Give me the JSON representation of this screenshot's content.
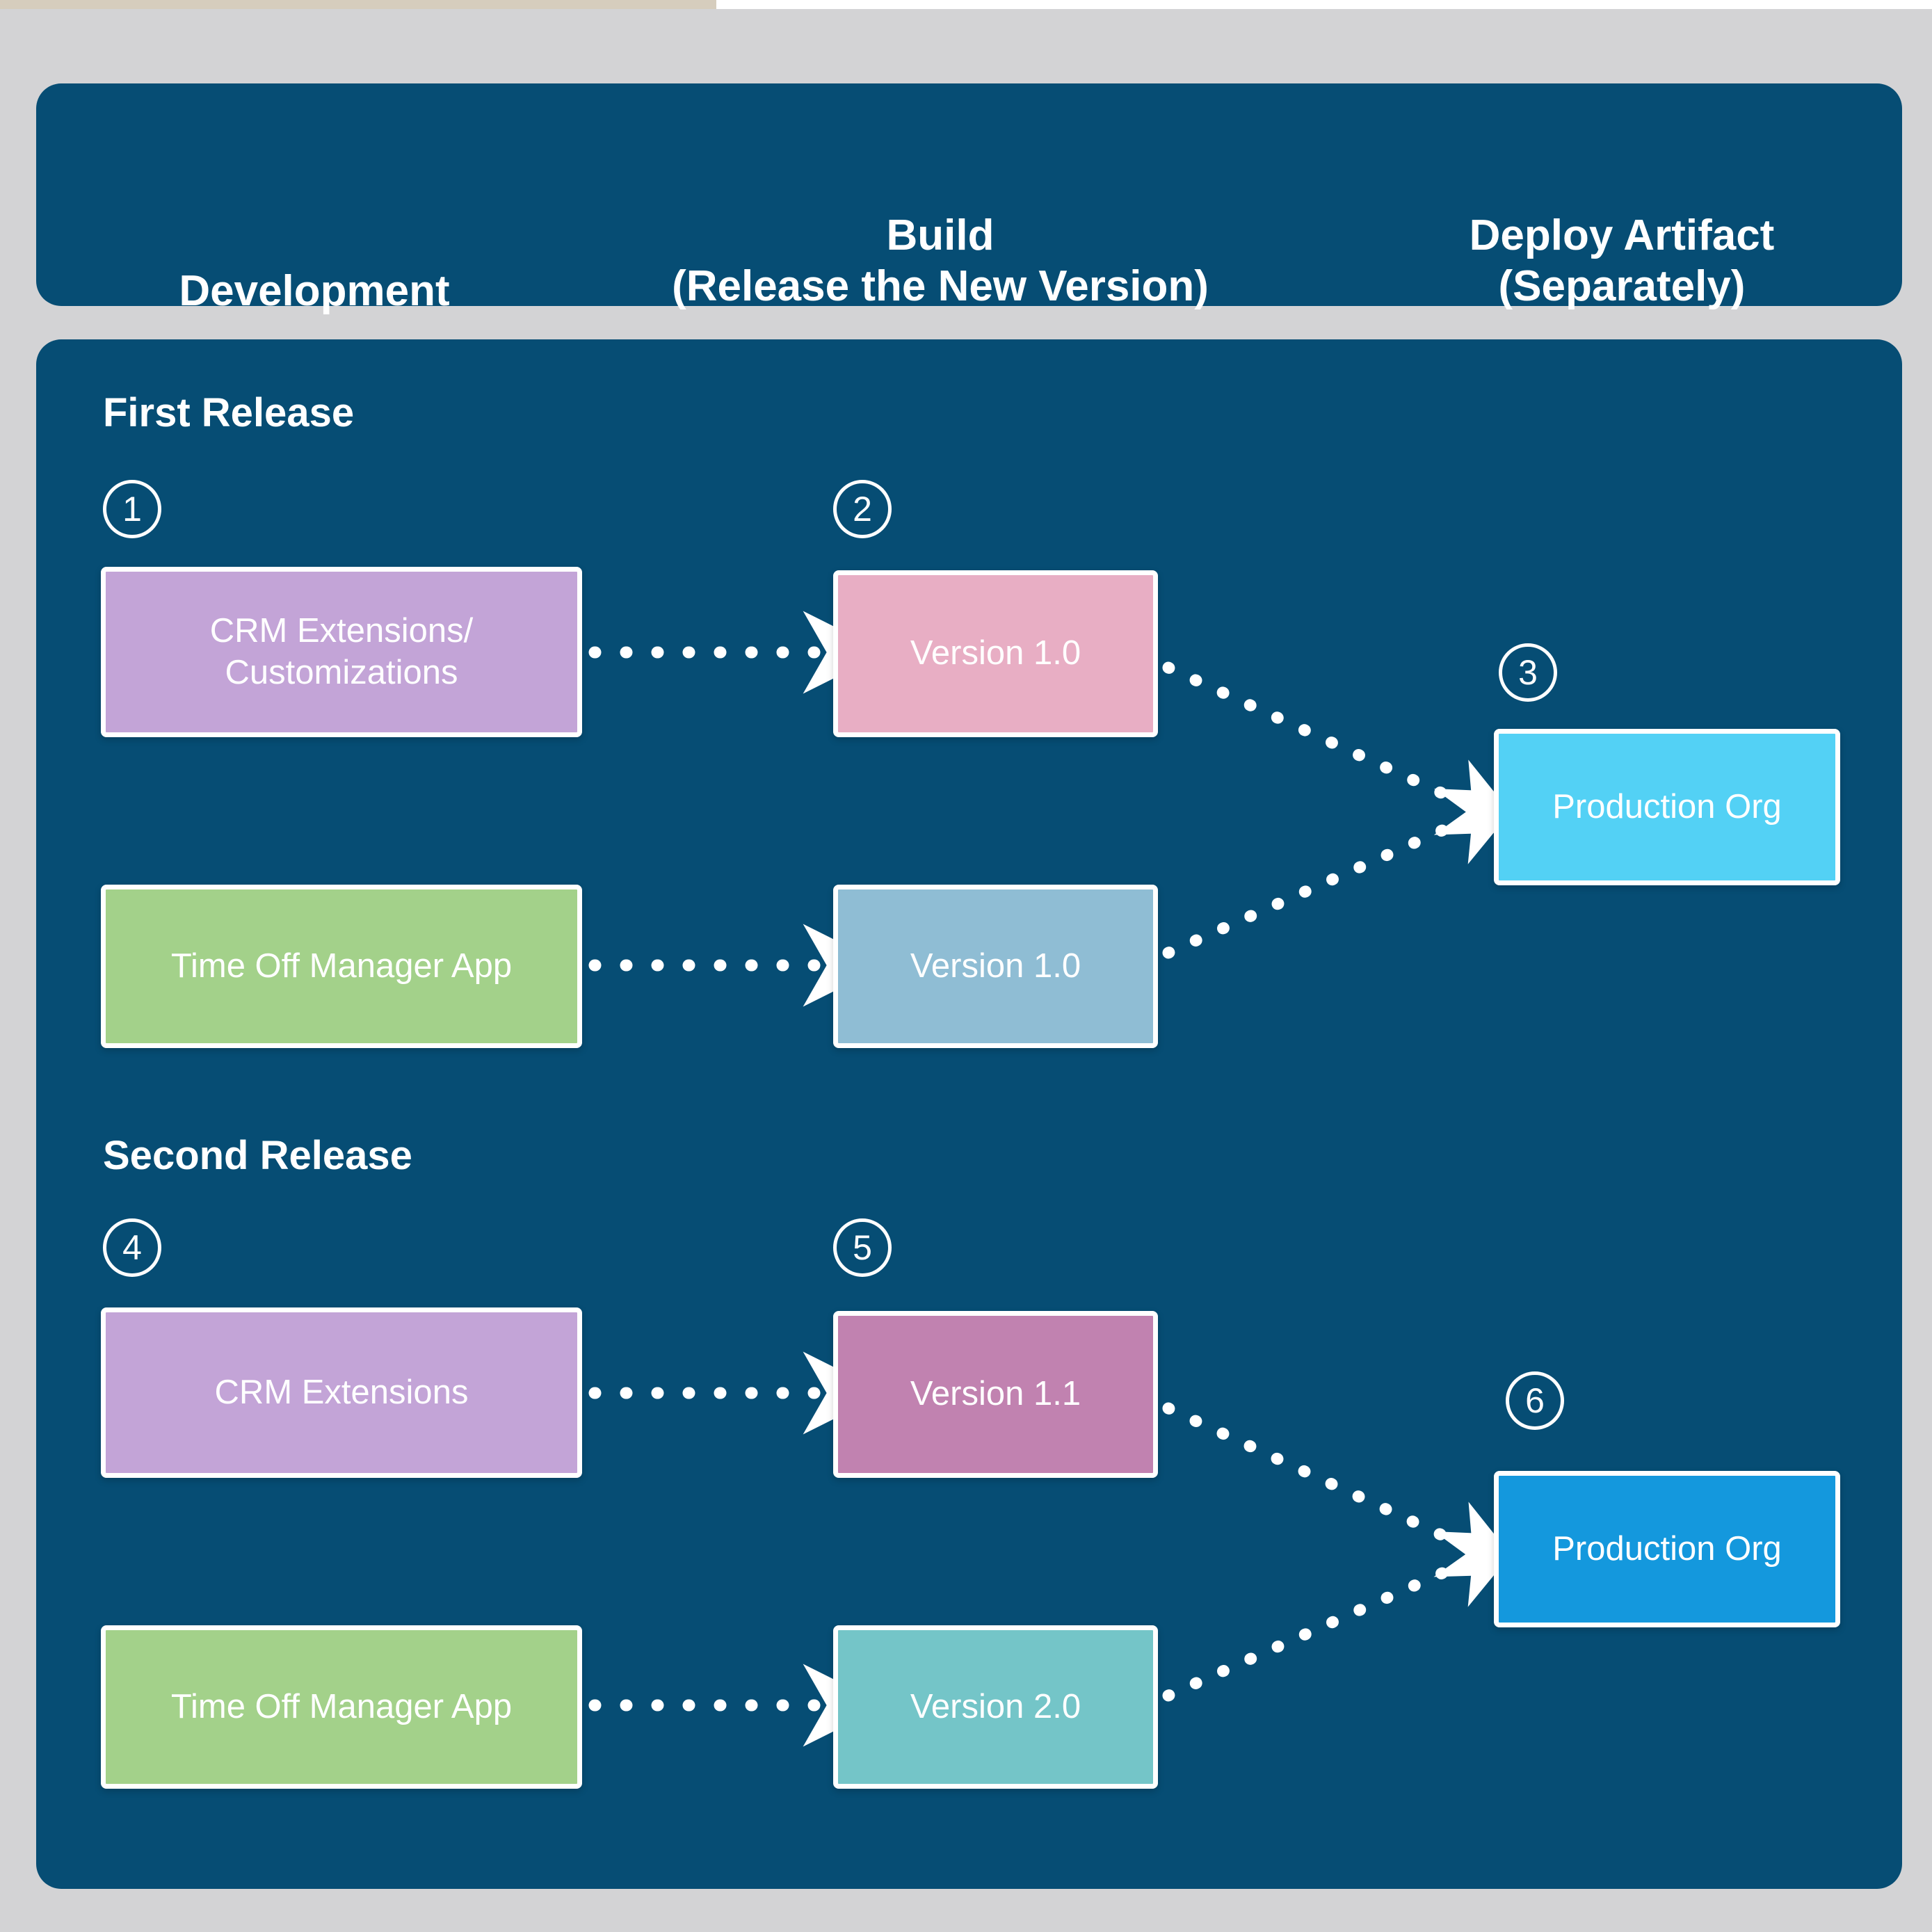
{
  "page": {
    "background_color": "#d3d3d5",
    "panel_color": "#064d74"
  },
  "header": {
    "columns": [
      {
        "id": "development",
        "label": "Development"
      },
      {
        "id": "build",
        "label": "Build\n(Release the New Version)",
        "line1": "Build",
        "line2": "(Release the New Version)"
      },
      {
        "id": "deploy",
        "label": "Deploy Artifact\n(Separately)",
        "line1": "Deploy Artifact",
        "line2": "(Separately)"
      }
    ]
  },
  "sections": [
    {
      "id": "first-release",
      "title": "First Release",
      "steps": [
        {
          "number": "1",
          "column": "development"
        },
        {
          "number": "2",
          "column": "build"
        },
        {
          "number": "3",
          "column": "deploy"
        }
      ],
      "nodes": [
        {
          "id": "crm-extensions-customizations",
          "label": "CRM Extensions/\nCustomizations",
          "line1": "CRM Extensions/",
          "line2": "Customizations",
          "color": "#c3a4d7",
          "column": "development"
        },
        {
          "id": "version-1-0-crm",
          "label": "Version 1.0",
          "color": "#e8aec4",
          "column": "build"
        },
        {
          "id": "time-off-manager-app-1",
          "label": "Time Off Manager App",
          "color": "#a3d18a",
          "column": "development"
        },
        {
          "id": "version-1-0-timeoff",
          "label": "Version 1.0",
          "color": "#8fbdd4",
          "column": "build"
        },
        {
          "id": "production-org-1",
          "label": "Production Org",
          "color": "#53d1f5",
          "column": "deploy"
        }
      ]
    },
    {
      "id": "second-release",
      "title": "Second Release",
      "steps": [
        {
          "number": "4",
          "column": "development"
        },
        {
          "number": "5",
          "column": "build"
        },
        {
          "number": "6",
          "column": "deploy"
        }
      ],
      "nodes": [
        {
          "id": "crm-extensions",
          "label": "CRM Extensions",
          "color": "#c3a4d7",
          "column": "development"
        },
        {
          "id": "version-1-1",
          "label": "Version 1.1",
          "color": "#c182b0",
          "column": "build"
        },
        {
          "id": "time-off-manager-app-2",
          "label": "Time Off Manager App",
          "color": "#a3d18a",
          "column": "development"
        },
        {
          "id": "version-2-0",
          "label": "Version 2.0",
          "color": "#74c5c8",
          "column": "build"
        },
        {
          "id": "production-org-2",
          "label": "Production Org",
          "color": "#1498dd",
          "column": "deploy"
        }
      ]
    }
  ],
  "edges": [
    {
      "id": "edge-crm-to-v10",
      "from": "crm-extensions-customizations",
      "to": "version-1-0-crm",
      "style": "dotted-arrow"
    },
    {
      "id": "edge-v10crm-to-prod1",
      "from": "version-1-0-crm",
      "to": "production-org-1",
      "style": "dotted-arrow"
    },
    {
      "id": "edge-timeoff1-to-v10",
      "from": "time-off-manager-app-1",
      "to": "version-1-0-timeoff",
      "style": "dotted-arrow"
    },
    {
      "id": "edge-v10timeoff-to-prod1",
      "from": "version-1-0-timeoff",
      "to": "production-org-1",
      "style": "dotted-arrow"
    },
    {
      "id": "edge-crmext-to-v11",
      "from": "crm-extensions",
      "to": "version-1-1",
      "style": "dotted-arrow"
    },
    {
      "id": "edge-v11-to-prod2",
      "from": "version-1-1",
      "to": "production-org-2",
      "style": "dotted-arrow"
    },
    {
      "id": "edge-timeoff2-to-v20",
      "from": "time-off-manager-app-2",
      "to": "version-2-0",
      "style": "dotted-arrow"
    },
    {
      "id": "edge-v20-to-prod2",
      "from": "version-2-0",
      "to": "production-org-2",
      "style": "dotted-arrow"
    }
  ]
}
